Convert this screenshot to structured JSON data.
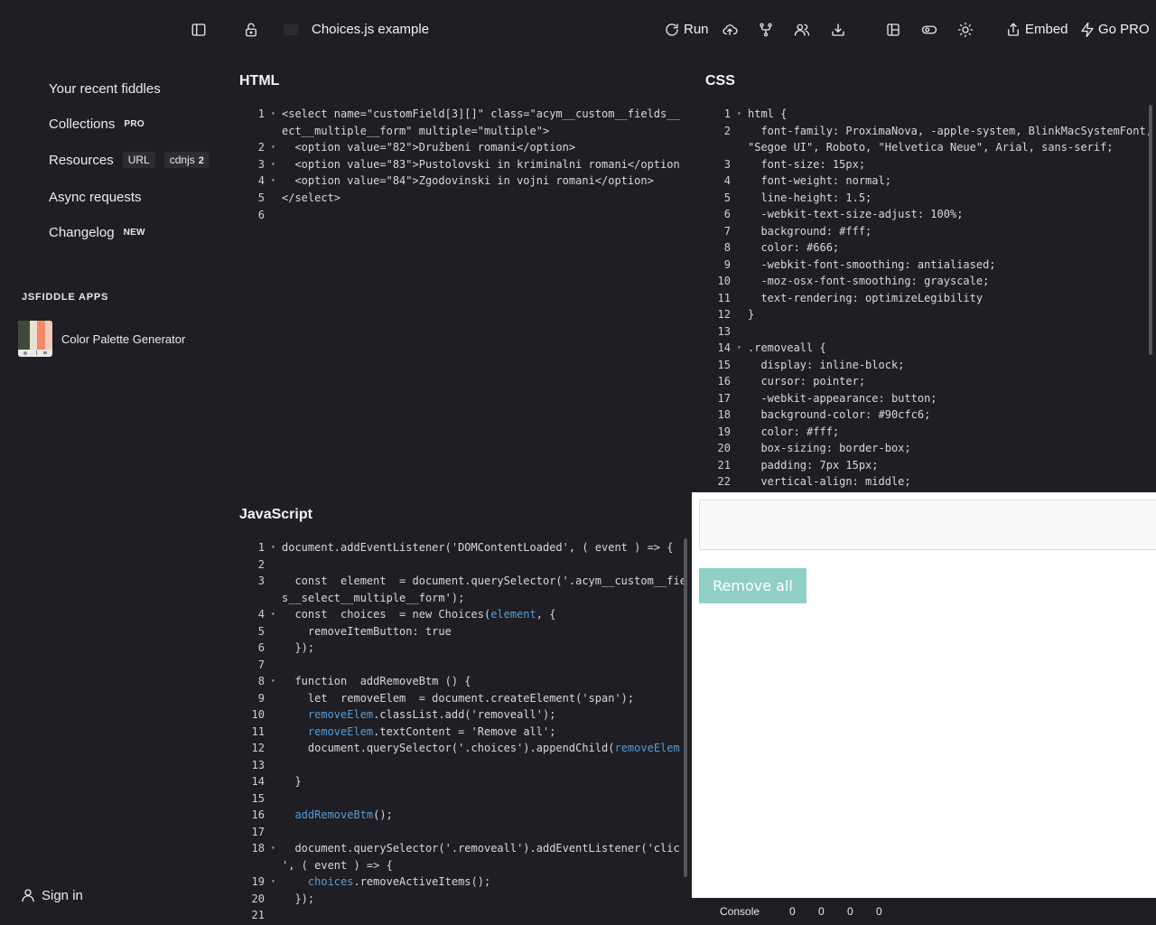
{
  "topbar": {
    "es_badge": "ES",
    "title": "Choices.js example",
    "run_label": "Run",
    "embed_label": "Embed",
    "gopro_label": "Go PRO"
  },
  "sidebar": {
    "items": [
      {
        "label": "Your recent fiddles"
      },
      {
        "label": "Collections",
        "tag": "PRO"
      },
      {
        "label": "Resources",
        "tag1": "URL",
        "tag2": "cdnjs",
        "count": "2"
      },
      {
        "label": "Async requests"
      },
      {
        "label": "Changelog",
        "tag": "NEW"
      }
    ],
    "apps_heading": "JSFIDDLE APPS",
    "app_name": "Color Palette Generator",
    "sign_in": "Sign in"
  },
  "panels": {
    "html_title": "HTML",
    "css_title": "CSS",
    "js_title": "JavaScript"
  },
  "html_code": [
    {
      "n": "1",
      "fold": true,
      "t": "<select name=\"customField[3][]\" class=\"acym__custom__fields__"
    },
    {
      "n": "",
      "fold": false,
      "t": "ect__multiple__form\" multiple=\"multiple\">"
    },
    {
      "n": "2",
      "fold": true,
      "t": "  <option value=\"82\">Družbeni romani</option>"
    },
    {
      "n": "3",
      "fold": true,
      "t": "  <option value=\"83\">Pustolovski in kriminalni romani</option"
    },
    {
      "n": "4",
      "fold": true,
      "t": "  <option value=\"84\">Zgodovinski in vojni romani</option>"
    },
    {
      "n": "5",
      "fold": false,
      "t": "</select>"
    },
    {
      "n": "6",
      "fold": false,
      "t": ""
    }
  ],
  "css_code": [
    {
      "n": "1",
      "fold": true,
      "t": "html {"
    },
    {
      "n": "2",
      "fold": false,
      "t": "  font-family: ProximaNova, -apple-system, BlinkMacSystemFont,"
    },
    {
      "n": "",
      "fold": false,
      "t": "\"Segoe UI\", Roboto, \"Helvetica Neue\", Arial, sans-serif;"
    },
    {
      "n": "3",
      "fold": false,
      "t": "  font-size: 15px;"
    },
    {
      "n": "4",
      "fold": false,
      "t": "  font-weight: normal;"
    },
    {
      "n": "5",
      "fold": false,
      "t": "  line-height: 1.5;"
    },
    {
      "n": "6",
      "fold": false,
      "t": "  -webkit-text-size-adjust: 100%;"
    },
    {
      "n": "7",
      "fold": false,
      "t": "  background: #fff;"
    },
    {
      "n": "8",
      "fold": false,
      "t": "  color: #666;"
    },
    {
      "n": "9",
      "fold": false,
      "t": "  -webkit-font-smoothing: antialiased;"
    },
    {
      "n": "10",
      "fold": false,
      "t": "  -moz-osx-font-smoothing: grayscale;"
    },
    {
      "n": "11",
      "fold": false,
      "t": "  text-rendering: optimizeLegibility"
    },
    {
      "n": "12",
      "fold": false,
      "t": "}"
    },
    {
      "n": "13",
      "fold": false,
      "t": ""
    },
    {
      "n": "14",
      "fold": true,
      "t": ".removeall {"
    },
    {
      "n": "15",
      "fold": false,
      "t": "  display: inline-block;"
    },
    {
      "n": "16",
      "fold": false,
      "t": "  cursor: pointer;"
    },
    {
      "n": "17",
      "fold": false,
      "t": "  -webkit-appearance: button;"
    },
    {
      "n": "18",
      "fold": false,
      "t": "  background-color: #90cfc6;"
    },
    {
      "n": "19",
      "fold": false,
      "t": "  color: #fff;"
    },
    {
      "n": "20",
      "fold": false,
      "t": "  box-sizing: border-box;"
    },
    {
      "n": "21",
      "fold": false,
      "t": "  padding: 7px 15px;"
    },
    {
      "n": "22",
      "fold": false,
      "t": "  vertical-align: middle;"
    }
  ],
  "js_code": [
    {
      "n": "1",
      "fold": true,
      "t": "document.addEventListener('DOMContentLoaded', ( event ) => {"
    },
    {
      "n": "2",
      "fold": false,
      "t": ""
    },
    {
      "n": "3",
      "fold": false,
      "t": "  const  element  = document.querySelector('.acym__custom__fie"
    },
    {
      "n": "",
      "fold": false,
      "t": "s__select__multiple__form');"
    },
    {
      "n": "4",
      "fold": true,
      "t": "  const  choices  = new Choices(",
      "hl": "element",
      "t2": ", {"
    },
    {
      "n": "5",
      "fold": false,
      "t": "    removeItemButton: true"
    },
    {
      "n": "6",
      "fold": false,
      "t": "  });"
    },
    {
      "n": "7",
      "fold": false,
      "t": ""
    },
    {
      "n": "8",
      "fold": true,
      "t": "  function  addRemoveBtm () {"
    },
    {
      "n": "9",
      "fold": false,
      "t": "    let  removeElem  = document.createElement('span');"
    },
    {
      "n": "10",
      "fold": false,
      "t": "    ",
      "hl": "removeElem",
      "t2": ".classList.add('removeall');"
    },
    {
      "n": "11",
      "fold": false,
      "t": "    ",
      "hl": "removeElem",
      "t2": ".textContent = 'Remove all';"
    },
    {
      "n": "12",
      "fold": false,
      "t": "    document.querySelector('.choices').appendChild(",
      "hl": "removeElem",
      "t2": ""
    },
    {
      "n": "13",
      "fold": false,
      "t": ""
    },
    {
      "n": "14",
      "fold": false,
      "t": "  }"
    },
    {
      "n": "15",
      "fold": false,
      "t": ""
    },
    {
      "n": "16",
      "fold": false,
      "t": "  ",
      "hl": "addRemoveBtm",
      "t2": "();"
    },
    {
      "n": "17",
      "fold": false,
      "t": ""
    },
    {
      "n": "18",
      "fold": true,
      "t": "  document.querySelector('.removeall').addEventListener('clic"
    },
    {
      "n": "",
      "fold": false,
      "t": "', ( event ) => {"
    },
    {
      "n": "19",
      "fold": true,
      "t": "    ",
      "hl": "choices",
      "t2": ".removeActiveItems();"
    },
    {
      "n": "20",
      "fold": false,
      "t": "  });"
    },
    {
      "n": "21",
      "fold": false,
      "t": ""
    }
  ],
  "result": {
    "remove_all_label": "Remove all"
  },
  "console": {
    "label": "Console",
    "counts": [
      "0",
      "0",
      "0",
      "0"
    ]
  }
}
